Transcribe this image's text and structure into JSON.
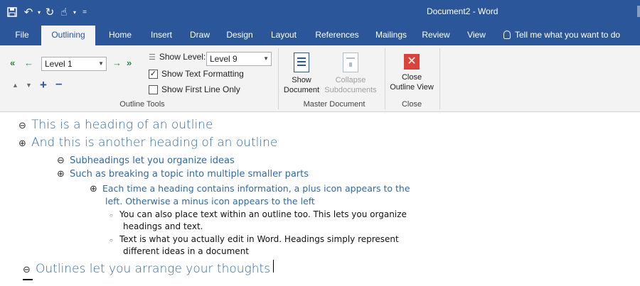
{
  "window": {
    "title": "Document2 - Word",
    "qat": {
      "save_icon": "save-icon",
      "undo_icon": "undo-icon",
      "redo_icon": "redo-icon",
      "touch_icon": "touch-mode-icon",
      "customize_icon": "customize-qat-icon"
    }
  },
  "tabs": [
    {
      "label": "File"
    },
    {
      "label": "Outlining",
      "active": true
    },
    {
      "label": "Home"
    },
    {
      "label": "Insert"
    },
    {
      "label": "Draw"
    },
    {
      "label": "Design"
    },
    {
      "label": "Layout"
    },
    {
      "label": "References"
    },
    {
      "label": "Mailings"
    },
    {
      "label": "Review"
    },
    {
      "label": "View"
    }
  ],
  "tell_me": "Tell me what you want to do",
  "ribbon": {
    "outline_tools": {
      "label": "Outline Tools",
      "level_value": "Level 1",
      "show_level_label": "Show Level:",
      "show_level_value": "Level 9",
      "show_text_formatting": "Show Text Formatting",
      "show_text_formatting_checked": true,
      "show_first_line_only": "Show First Line Only",
      "show_first_line_only_checked": false
    },
    "master_document": {
      "label": "Master Document",
      "show_document_1": "Show",
      "show_document_2": "Document",
      "collapse_subdocuments_1": "Collapse",
      "collapse_subdocuments_2": "Subdocuments"
    },
    "close": {
      "label": "Close",
      "close_outline_view_1": "Close",
      "close_outline_view_2": "Outline View"
    }
  },
  "outline": [
    {
      "symbol": "⊖",
      "text": "This is a heading of an outline"
    },
    {
      "symbol": "⊕",
      "text": "And this is another heading of an outline"
    },
    {
      "symbol": "⊖",
      "text": "Subheadings let you organize ideas"
    },
    {
      "symbol": "⊕",
      "text": "Such as breaking a topic into multiple smaller parts"
    },
    {
      "symbol": "⊕",
      "text": "Each time a heading contains information, a plus icon appears to the",
      "text2": "left. Otherwise a minus icon appears to the left"
    },
    {
      "symbol": "○",
      "text": "You can also place text within an outline too. This lets you organize",
      "text2": "headings and text."
    },
    {
      "symbol": "○",
      "text": "Text is what you actually edit in Word. Headings simply represent",
      "text2": "different ideas in a document"
    },
    {
      "symbol": "⊖",
      "text": "Outlines let you arrange your thoughts"
    }
  ],
  "colors": {
    "accent": "#2b579a",
    "heading": "#2f6aa8",
    "close_red": "#d9433b"
  }
}
